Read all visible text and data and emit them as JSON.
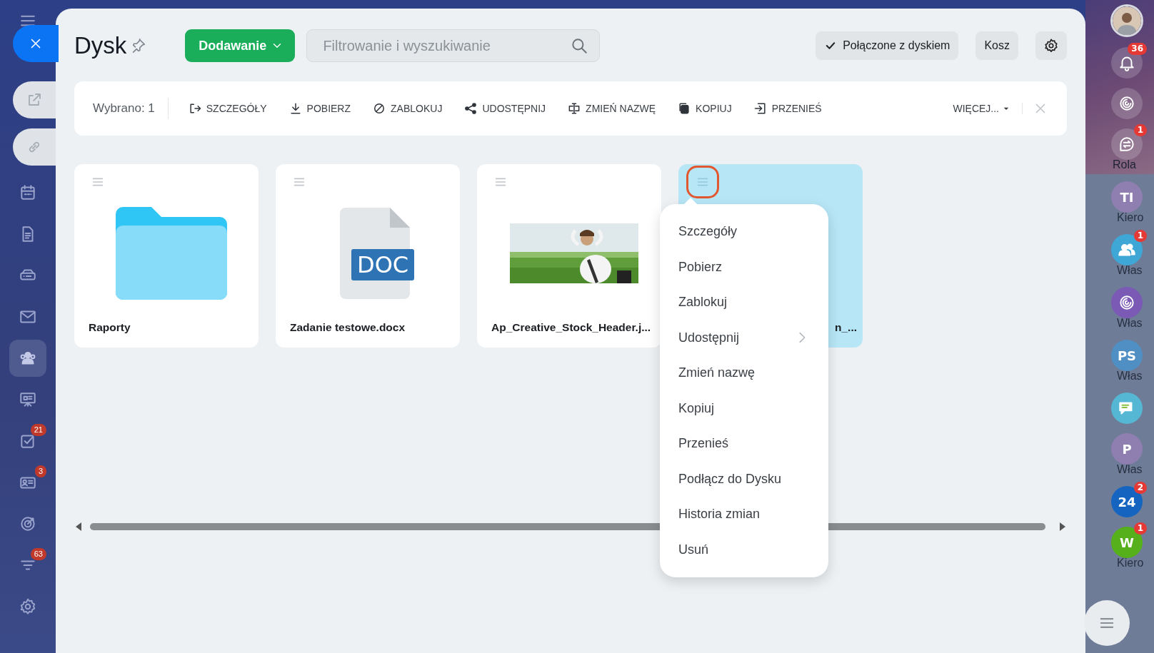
{
  "left_nav": {
    "items": [
      {
        "selected": false
      },
      {
        "selected": false
      },
      {
        "selected": false
      },
      {
        "selected": false
      },
      {
        "selected": true
      },
      {
        "selected": false
      },
      {
        "selected": false,
        "badge": "21"
      },
      {
        "selected": false,
        "badge": "3"
      },
      {
        "selected": false
      },
      {
        "selected": false,
        "badge": "63"
      },
      {
        "selected": false
      }
    ]
  },
  "header": {
    "title": "Dysk",
    "add_button": "Dodawanie",
    "search": {
      "placeholder": "Filtrowanie i wyszukiwanie"
    },
    "connected_button": "Połączone z dyskiem",
    "trash_button": "Kosz"
  },
  "selection_bar": {
    "selected_count": "Wybrano: 1",
    "actions": [
      {
        "label": "SZCZEGÓŁY"
      },
      {
        "label": "POBIERZ"
      },
      {
        "label": "ZABLOKUJ"
      },
      {
        "label": "UDOSTĘPNIJ"
      },
      {
        "label": "ZMIEŃ NAZWĘ"
      },
      {
        "label": "KOPIUJ"
      },
      {
        "label": "PRZENIEŚ"
      }
    ],
    "more": "WIĘCEJ..."
  },
  "files": [
    {
      "kind": "folder",
      "name": "Raporty",
      "selected": false
    },
    {
      "kind": "doc",
      "name": "Zadanie testowe.docx",
      "doc_label": "DOC",
      "selected": false
    },
    {
      "kind": "picture",
      "name": "Ap_Creative_Stock_Header.j...",
      "selected": false
    },
    {
      "kind": "blank",
      "name": "n_...",
      "selected": true
    }
  ],
  "context_menu": {
    "items": [
      {
        "label": "Szczegóły",
        "submenu": false
      },
      {
        "label": "Pobierz",
        "submenu": false
      },
      {
        "label": "Zablokuj",
        "submenu": false
      },
      {
        "label": "Udostępnij",
        "submenu": true
      },
      {
        "label": "Zmień nazwę",
        "submenu": false
      },
      {
        "label": "Kopiuj",
        "submenu": false
      },
      {
        "label": "Przenieś",
        "submenu": false
      },
      {
        "label": "Podłącz do Dysku",
        "submenu": false
      },
      {
        "label": "Historia zmian",
        "submenu": false
      },
      {
        "label": "Usuń",
        "submenu": false
      }
    ]
  },
  "right_bar": {
    "items": [
      {
        "kind": "bell",
        "badge": "36"
      },
      {
        "kind": "spiral"
      },
      {
        "kind": "chat",
        "badge": "1",
        "label": "Rola"
      },
      {
        "kind": "initials",
        "text": "TI",
        "color": "#8e7fb0",
        "label": "Kiero"
      },
      {
        "kind": "group",
        "badge": "1",
        "color": "#3ea7d6",
        "label": "Włas"
      },
      {
        "kind": "spiral-avatar",
        "color": "#7a5ab5",
        "label": "Włas"
      },
      {
        "kind": "initials",
        "text": "PS",
        "color": "#4f8fc4",
        "label": "Włas"
      },
      {
        "kind": "message",
        "color": "#55b7d4"
      },
      {
        "kind": "initials",
        "text": "P",
        "color": "#8e7fb0",
        "label": "Włas"
      },
      {
        "kind": "initials",
        "text": "24",
        "color": "#1565c0",
        "badge": "2"
      },
      {
        "kind": "initials",
        "text": "W",
        "color": "#56b01c",
        "badge": "1",
        "label": "Kiero"
      }
    ]
  }
}
